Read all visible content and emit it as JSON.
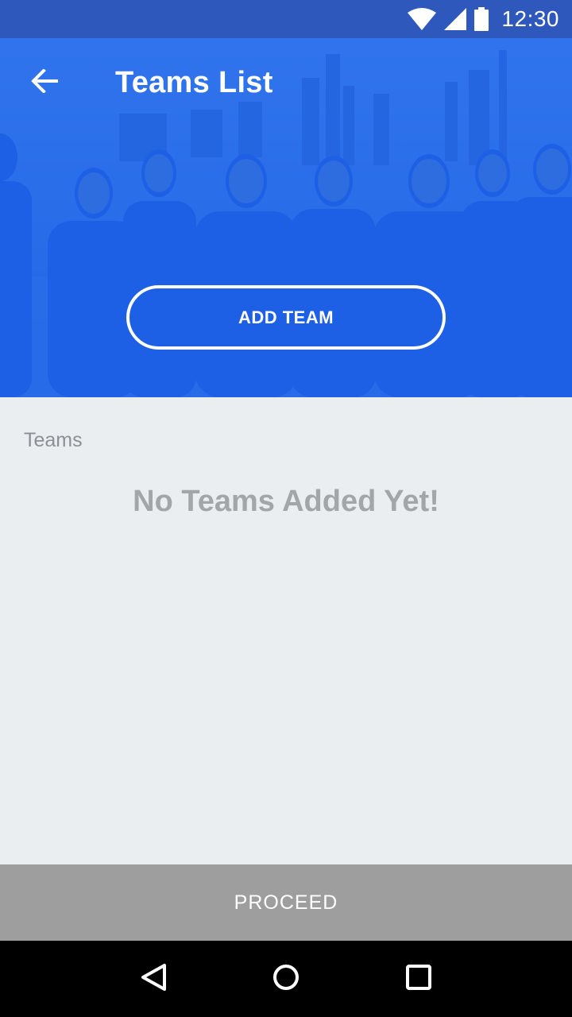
{
  "status_bar": {
    "time": "12:30",
    "icons": [
      "wifi-icon",
      "cell-signal-icon",
      "battery-icon"
    ]
  },
  "toolbar": {
    "title": "Teams List",
    "back_icon": "arrow-back-icon"
  },
  "hero": {
    "add_team_label": "ADD TEAM",
    "overlay_color": "#1c68f0"
  },
  "content": {
    "section_label": "Teams",
    "empty_message": "No Teams Added Yet!"
  },
  "footer": {
    "proceed_label": "PROCEED",
    "proceed_color": "#9e9e9e"
  },
  "nav_bar": {
    "icons": [
      "nav-back-icon",
      "nav-home-icon",
      "nav-recents-icon"
    ]
  }
}
